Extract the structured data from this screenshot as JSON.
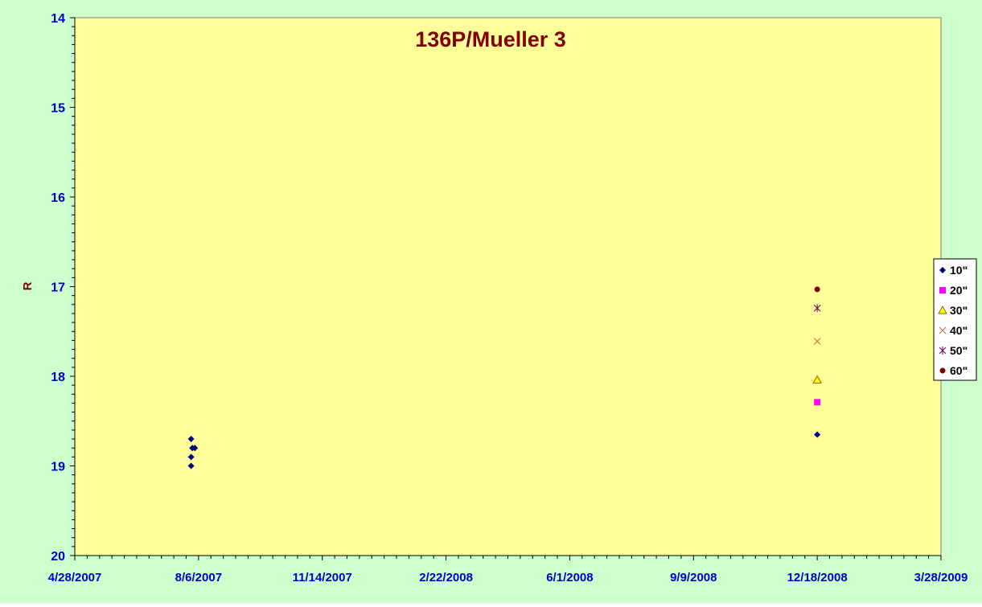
{
  "chart_data": {
    "type": "scatter",
    "title": "136P/Mueller 3",
    "xlabel": "",
    "ylabel": "R",
    "x_axis": {
      "type": "date",
      "min": "2007-04-28",
      "max": "2009-03-28",
      "tick_labels": [
        "4/28/2007",
        "8/6/2007",
        "11/14/2007",
        "2/22/2008",
        "6/1/2008",
        "9/9/2008",
        "12/18/2008",
        "3/28/2009"
      ]
    },
    "y_axis": {
      "min": 14,
      "max": 20,
      "inverted": true,
      "tick_labels": [
        "14",
        "15",
        "16",
        "17",
        "18",
        "19",
        "20"
      ]
    },
    "grid": false,
    "legend_position": "right",
    "colors": {
      "outer_background": "#ccffcc",
      "plot_background": "#ffff99",
      "title": "#800000",
      "axis_title": "#800000",
      "tick_labels": "#0000cc"
    },
    "series": [
      {
        "name": "10\"",
        "marker": "diamond",
        "color": "#000080",
        "points": [
          {
            "x": "2007-07-31",
            "y": 18.7
          },
          {
            "x": "2007-08-01",
            "y": 18.8
          },
          {
            "x": "2007-08-03",
            "y": 18.8
          },
          {
            "x": "2007-07-31",
            "y": 18.9
          },
          {
            "x": "2007-07-31",
            "y": 19.0
          },
          {
            "x": "2008-12-18",
            "y": 18.65
          }
        ]
      },
      {
        "name": "20\"",
        "marker": "square",
        "color": "#ff00ff",
        "points": [
          {
            "x": "2008-12-18",
            "y": 18.29
          }
        ]
      },
      {
        "name": "30\"",
        "marker": "triangle",
        "color": "#ffff00",
        "stroke": "#996600",
        "points": [
          {
            "x": "2008-12-18",
            "y": 18.04
          }
        ]
      },
      {
        "name": "40\"",
        "marker": "x",
        "color": "#cc6633",
        "points": [
          {
            "x": "2008-12-18",
            "y": 17.61
          }
        ]
      },
      {
        "name": "50\"",
        "marker": "star",
        "color": "#660066",
        "points": [
          {
            "x": "2008-12-18",
            "y": 17.24
          }
        ]
      },
      {
        "name": "60\"",
        "marker": "circle",
        "color": "#800000",
        "points": [
          {
            "x": "2008-12-18",
            "y": 17.03
          }
        ]
      }
    ]
  }
}
